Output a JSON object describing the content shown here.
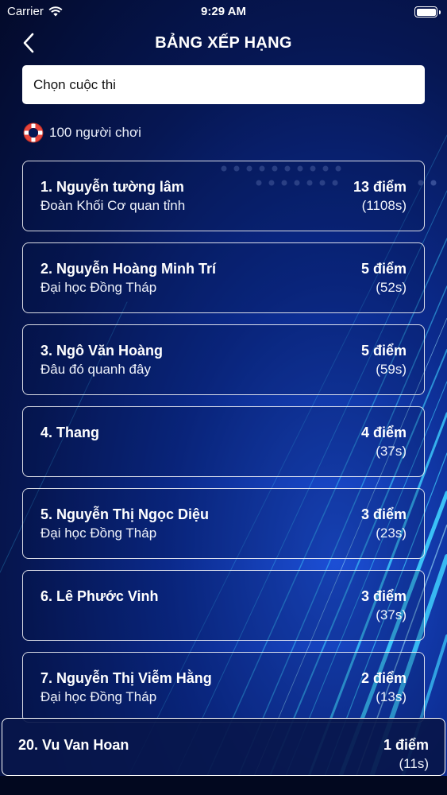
{
  "status_bar": {
    "carrier": "Carrier",
    "time": "9:29 AM"
  },
  "nav": {
    "title": "BẢNG XẾP HẠNG"
  },
  "contest_select": {
    "value": "Chọn cuộc thi"
  },
  "player_count": "100 người chơi",
  "leaderboard": [
    {
      "name": "1. Nguyễn tường lâm",
      "org": "Đoàn Khối Cơ quan tỉnh",
      "score": "13 điểm",
      "time": "(1108s)"
    },
    {
      "name": "2. Nguyễn Hoàng Minh Trí",
      "org": "Đại học Đồng Tháp",
      "score": "5 điểm",
      "time": "(52s)"
    },
    {
      "name": "3. Ngô Văn Hoàng",
      "org": "Đâu đó quanh đây",
      "score": "5 điểm",
      "time": "(59s)"
    },
    {
      "name": "4. Thang",
      "org": "",
      "score": "4 điểm",
      "time": "(37s)"
    },
    {
      "name": "5. Nguyễn Thị Ngọc Diệu",
      "org": "Đại học Đồng Tháp",
      "score": "3 điểm",
      "time": "(23s)"
    },
    {
      "name": "6. Lê Phước Vinh",
      "org": "",
      "score": "3 điểm",
      "time": "(37s)"
    },
    {
      "name": "7. Nguyễn Thị Viễm Hằng",
      "org": "Đại học Đồng Tháp",
      "score": "2 điểm",
      "time": "(13s)"
    }
  ],
  "current_user": {
    "name": "20. Vu Van Hoan",
    "score": "1 điểm",
    "time": "(11s)"
  },
  "colors": {
    "background": "#061754",
    "accent_lines": "#3fd0ff",
    "card_border": "#ffffff",
    "lifebuoy": "#e8453c"
  },
  "icons": {
    "back": "chevron-left-icon",
    "wifi": "wifi-icon",
    "battery": "battery-icon",
    "players": "lifebuoy-icon"
  }
}
